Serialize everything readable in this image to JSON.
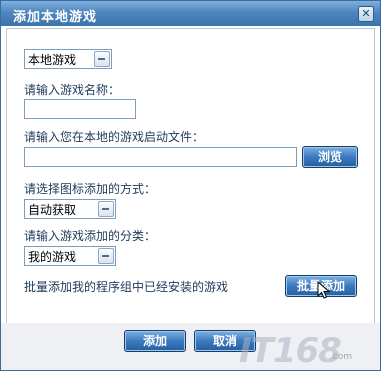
{
  "dialog": {
    "title": "添加本地游戏",
    "close_icon": "close-icon"
  },
  "source_select": {
    "value": "本地游戏"
  },
  "name_field": {
    "label": "请输入游戏名称：",
    "value": ""
  },
  "file_field": {
    "label": "请输入您在本地的游戏启动文件：",
    "value": "",
    "browse_label": "浏览"
  },
  "icon_method": {
    "label": "请选择图标添加的方式：",
    "value": "自动获取"
  },
  "category": {
    "label": "请输入游戏添加的分类：",
    "value": "我的游戏"
  },
  "batch": {
    "text": "批量添加我的程序组中已经安装的游戏",
    "button_label": "批量添加"
  },
  "footer": {
    "add_label": "添加",
    "cancel_label": "取消"
  },
  "watermark": {
    "logo": "IT168",
    "domain": ".com"
  }
}
